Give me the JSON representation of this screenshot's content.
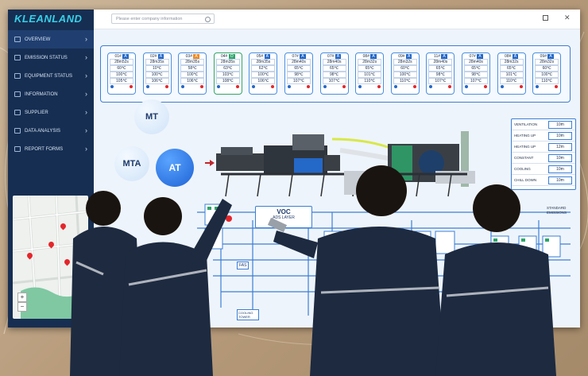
{
  "app": {
    "logo": "KLEANLAND"
  },
  "sidebar": {
    "items": [
      {
        "label": "OVERVIEW",
        "active": true
      },
      {
        "label": "EMISSION STATUS"
      },
      {
        "label": "EQUIPMENT STATUS"
      },
      {
        "label": "INFORMATION"
      },
      {
        "label": "SUPPLIER"
      },
      {
        "label": "DATA ANALYSIS"
      },
      {
        "label": "REPORT FORMS"
      }
    ],
    "map_zoom": {
      "plus": "+",
      "minus": "−"
    }
  },
  "search": {
    "placeholder": "Please enter company information"
  },
  "units": [
    {
      "id": "01#",
      "tag": "A",
      "time": "28m52s",
      "t1": "60℃",
      "t2": "100℃",
      "t3": "105℃"
    },
    {
      "id": "02#",
      "tag": "A",
      "time": "28m35s",
      "t1": "10℃",
      "t2": "100℃",
      "t3": "106℃"
    },
    {
      "id": "03#",
      "tag": "A",
      "time": "28m35s",
      "t1": "58℃",
      "t2": "100℃",
      "t3": "106℃"
    },
    {
      "id": "04#",
      "tag": "O",
      "time": "28m35s",
      "t1": "63℃",
      "t2": "103℃",
      "t3": "108℃"
    },
    {
      "id": "05#",
      "tag": "A",
      "time": "28m35s",
      "t1": "62℃",
      "t2": "100℃",
      "t3": "106℃"
    },
    {
      "id": "07#",
      "tag": "A",
      "time": "28m40s",
      "t1": "65℃",
      "t2": "98℃",
      "t3": "107℃"
    },
    {
      "id": "07#",
      "tag": "A",
      "time": "28m40s",
      "t1": "65℃",
      "t2": "98℃",
      "t3": "107℃"
    },
    {
      "id": "08#",
      "tag": "A",
      "time": "28m32s",
      "t1": "65℃",
      "t2": "101℃",
      "t3": "110℃"
    },
    {
      "id": "09#",
      "tag": "A",
      "time": "28m32s",
      "t1": "60℃",
      "t2": "100℃",
      "t3": "110℃"
    },
    {
      "id": "11#",
      "tag": "A",
      "time": "28m40s",
      "t1": "65℃",
      "t2": "98℃",
      "t3": "107℃"
    },
    {
      "id": "07#",
      "tag": "A",
      "time": "28m40s",
      "t1": "65℃",
      "t2": "98℃",
      "t3": "107℃"
    },
    {
      "id": "08#",
      "tag": "A",
      "time": "28m32s",
      "t1": "65℃",
      "t2": "101℃",
      "t3": "110℃"
    },
    {
      "id": "09#",
      "tag": "A",
      "time": "28m32s",
      "t1": "60℃",
      "t2": "100℃",
      "t3": "110℃"
    }
  ],
  "modes": {
    "mt": "MT",
    "mta": "MTA",
    "at": "AT"
  },
  "timings": [
    {
      "label": "VENTILATION",
      "value": "10m"
    },
    {
      "label": "HEATING UP",
      "value": "10m"
    },
    {
      "label": "HEATING UP",
      "value": "12m"
    },
    {
      "label": "CONSTANT",
      "value": "10m"
    },
    {
      "label": "COOLING",
      "value": "10m"
    },
    {
      "label": "CHILL DOWN",
      "value": "10m"
    }
  ],
  "scheme": {
    "voc_title": "VOC",
    "voc_sub": "ADS      LAYER",
    "standard": "STANDARD",
    "emissions": "EMISSIONS",
    "fas": "FAS",
    "cooling_tower": "COOLING TOWER"
  },
  "colors": {
    "sidebar": "#162e52",
    "accent": "#36d0e8",
    "blue": "#3b7fd6",
    "red": "#e4262b",
    "green": "#2ea56b"
  }
}
